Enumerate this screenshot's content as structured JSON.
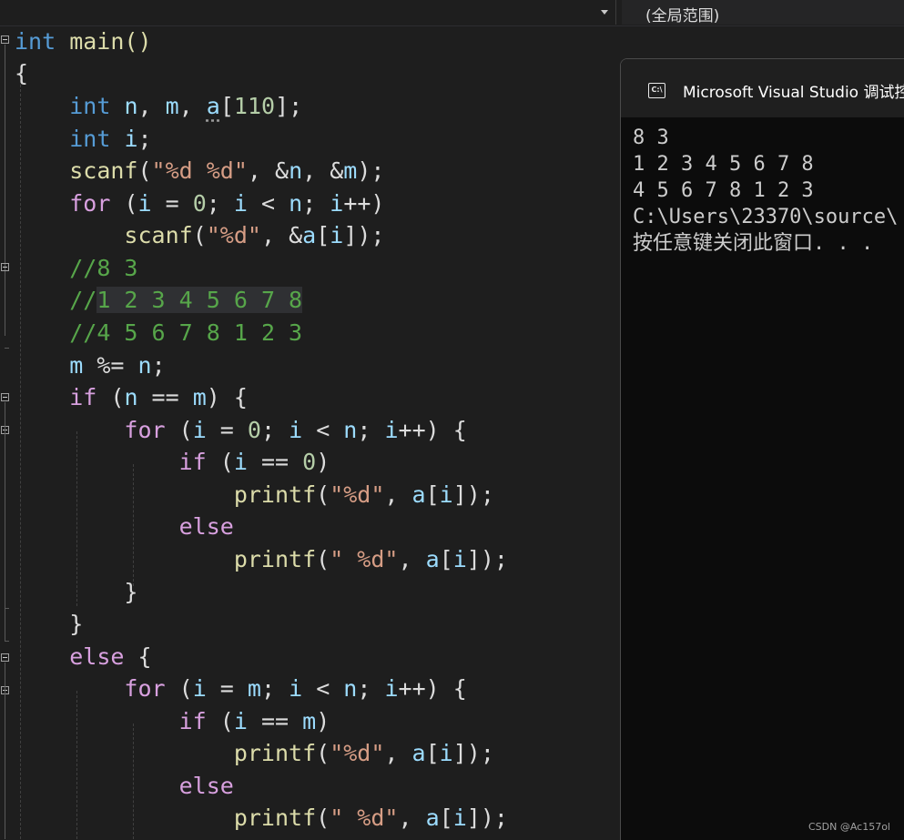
{
  "nav": {
    "scope": "(全局范围)"
  },
  "code": {
    "l1": {
      "kw": "int",
      "rest": " main()"
    },
    "l2": "{",
    "l3": {
      "kw": "int",
      "n": "n",
      "comma1": ", ",
      "m": "m",
      "comma2": ", ",
      "a": "a",
      "open": "[",
      "num": "110",
      "close": "];"
    },
    "l4": {
      "kw": "int",
      "i": "i",
      "semi": ";"
    },
    "l5": {
      "fn": "scanf",
      "open": "(",
      "str": "\"%d %d\"",
      "mid1": ", &",
      "n": "n",
      "mid2": ", &",
      "m": "m",
      "close": ");"
    },
    "l6": {
      "kw": "for",
      "p1": " (",
      "i1": "i",
      "p2": " = ",
      "zero": "0",
      "p3": "; ",
      "i2": "i",
      "p4": " < ",
      "n": "n",
      "p5": "; ",
      "i3": "i",
      "p6": "++)"
    },
    "l7": {
      "fn": "scanf",
      "open": "(",
      "str": "\"%d\"",
      "mid": ", &",
      "a": "a",
      "br": "[",
      "i": "i",
      "close": "]);"
    },
    "c1": {
      "slash": "//",
      "text": "8 3"
    },
    "c2": {
      "slash": "//",
      "text": "1 2 3 4 5 6 7 8"
    },
    "c3": {
      "slash": "//",
      "text": "4 5 6 7 8 1 2 3"
    },
    "l8": {
      "m": "m",
      "op": " %= ",
      "n": "n",
      "semi": ";"
    },
    "l9": {
      "kw": "if",
      "p1": " (",
      "n": "n",
      "op": " == ",
      "m": "m",
      "p2": ") {"
    },
    "l10": {
      "kw": "for",
      "p1": " (",
      "i1": "i",
      "p2": " = ",
      "zero": "0",
      "p3": "; ",
      "i2": "i",
      "p4": " < ",
      "n": "n",
      "p5": "; ",
      "i3": "i",
      "p6": "++) {"
    },
    "l11": {
      "kw": "if",
      "p1": " (",
      "i": "i",
      "op": " == ",
      "zero": "0",
      "p2": ")"
    },
    "l12": {
      "fn": "printf",
      "open": "(",
      "str": "\"%d\"",
      "mid": ", ",
      "a": "a",
      "br": "[",
      "i": "i",
      "close": "]);"
    },
    "l13": "else",
    "l14": {
      "fn": "printf",
      "open": "(",
      "str": "\" %d\"",
      "mid": ", ",
      "a": "a",
      "br": "[",
      "i": "i",
      "close": "]);"
    },
    "l15": "}",
    "l16": "}",
    "l17": {
      "kw": "else",
      "rest": " {"
    },
    "l18": {
      "kw": "for",
      "p1": " (",
      "i1": "i",
      "p2": " = ",
      "m": "m",
      "p3": "; ",
      "i2": "i",
      "p4": " < ",
      "n": "n",
      "p5": "; ",
      "i3": "i",
      "p6": "++) {"
    },
    "l19": {
      "kw": "if",
      "p1": " (",
      "i": "i",
      "op": " == ",
      "m": "m",
      "p2": ")"
    },
    "l20": {
      "fn": "printf",
      "open": "(",
      "str": "\"%d\"",
      "mid": ", ",
      "a": "a",
      "br": "[",
      "i": "i",
      "close": "]);"
    },
    "l21": "else",
    "l22": {
      "fn": "printf",
      "open": "(",
      "str": "\" %d\"",
      "mid": ", ",
      "a": "a",
      "br": "[",
      "i": "i",
      "close": "]);"
    }
  },
  "console": {
    "icon_text": "C:\\",
    "title": "Microsoft Visual Studio 调试控制台",
    "lines": [
      "8 3",
      "1 2 3 4 5 6 7 8",
      "4 5 6 7 8 1 2 3",
      "C:\\Users\\23370\\source\\",
      "按任意键关闭此窗口. . ."
    ]
  },
  "watermark": "CSDN @Ac157ol",
  "colors": {
    "editor_bg": "#1e1e1e",
    "keyword": "#569cd6",
    "control_flow": "#d8a0df",
    "function": "#dcdcaa",
    "variable": "#9cdcfe",
    "number": "#b5cea8",
    "string": "#d69d85",
    "comment": "#57a64a",
    "console_bg": "#0c0c0c"
  },
  "icons": [
    "dropdown-arrow-icon",
    "fold-collapse-icon",
    "console-app-icon"
  ]
}
